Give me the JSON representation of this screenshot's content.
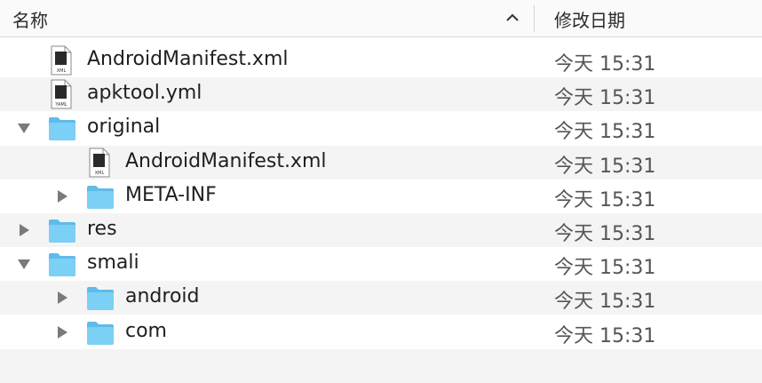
{
  "header": {
    "name_label": "名称",
    "date_label": "修改日期",
    "sort_direction": "ascending"
  },
  "colors": {
    "folder": "#7ccff5",
    "alt_row": "#f4f4f4",
    "disclosure": "#7a7a7a"
  },
  "rows": [
    {
      "name": "AndroidManifest.xml",
      "date": "今天 15:31",
      "type": "xml-file",
      "badge": "XML",
      "depth": 0,
      "disclosure": "none"
    },
    {
      "name": "apktool.yml",
      "date": "今天 15:31",
      "type": "yaml-file",
      "badge": "YAML",
      "depth": 0,
      "disclosure": "none"
    },
    {
      "name": "original",
      "date": "今天 15:31",
      "type": "folder",
      "depth": 0,
      "disclosure": "expanded"
    },
    {
      "name": "AndroidManifest.xml",
      "date": "今天 15:31",
      "type": "xml-file",
      "badge": "XML",
      "depth": 1,
      "disclosure": "none"
    },
    {
      "name": "META-INF",
      "date": "今天 15:31",
      "type": "folder",
      "depth": 1,
      "disclosure": "collapsed"
    },
    {
      "name": "res",
      "date": "今天 15:31",
      "type": "folder",
      "depth": 0,
      "disclosure": "collapsed"
    },
    {
      "name": "smali",
      "date": "今天 15:31",
      "type": "folder",
      "depth": 0,
      "disclosure": "expanded"
    },
    {
      "name": "android",
      "date": "今天 15:31",
      "type": "folder",
      "depth": 1,
      "disclosure": "collapsed"
    },
    {
      "name": "com",
      "date": "今天 15:31",
      "type": "folder",
      "depth": 1,
      "disclosure": "collapsed"
    }
  ]
}
